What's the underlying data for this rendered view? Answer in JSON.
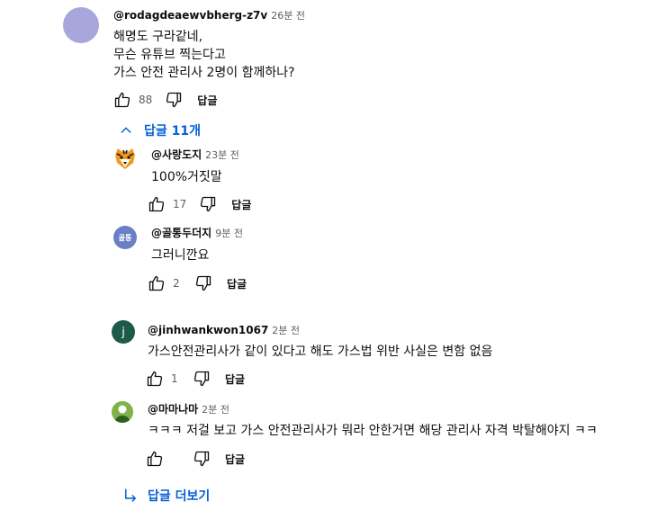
{
  "comment": {
    "author": "@rodagdeaewvbherg-z7v",
    "time": "26분 전",
    "text": "해명도 구라같네,\n무슨 유튜브 찍는다고\n가스 안전 관리사 2명이 함께하나?",
    "likes": "88",
    "reply_label": "답글",
    "avatar_color": "#a9a6dc"
  },
  "replies_toggle": {
    "label": "답글 11개"
  },
  "replies": [
    {
      "author": "@사랑도지",
      "time": "23분 전",
      "text": "100%거짓말",
      "likes": "17",
      "reply_label": "답글"
    },
    {
      "author": "@골통두더지",
      "time": "9분 전",
      "text": "그러니깐요",
      "likes": "2",
      "reply_label": "답글",
      "avatar_text": "골통",
      "avatar_color": "#6a7fc4"
    },
    {
      "author": "@jinhwankwon1067",
      "time": "2분 전",
      "text": "가스안전관리사가 같이 있다고 해도 가스법 위반 사실은 변함 없음",
      "likes": "1",
      "reply_label": "답글",
      "avatar_text": "j",
      "avatar_color": "#1e5a4a"
    },
    {
      "author": "@마마나마",
      "time": "2분 전",
      "text": "ㅋㅋㅋ 저걸 보고 가스 안전관리사가 뭐라 안한거면 해당 관리사 자격 박탈해야지 ㅋㅋ",
      "likes": "",
      "reply_label": "답글"
    }
  ],
  "more_replies": {
    "label": "답글 더보기"
  },
  "colors": {
    "link": "#065fd4",
    "secondary": "#606060"
  }
}
